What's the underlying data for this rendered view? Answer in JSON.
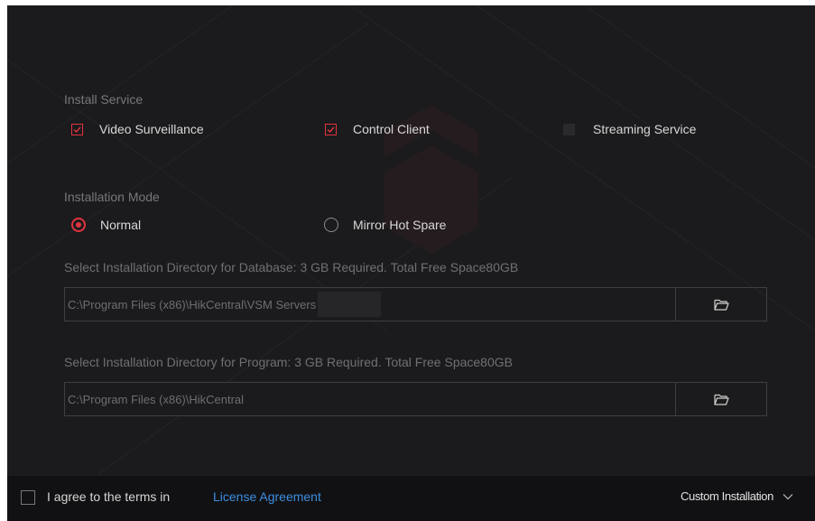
{
  "install_service": {
    "title": "Install Service",
    "options": [
      {
        "label": "Video Surveillance",
        "checked": true
      },
      {
        "label": "Control Client",
        "checked": true
      },
      {
        "label": "Streaming Service",
        "checked": false
      }
    ]
  },
  "installation_mode": {
    "title": "Installation Mode",
    "options": [
      {
        "label": "Normal",
        "selected": true
      },
      {
        "label": "Mirror Hot Spare",
        "selected": false
      }
    ]
  },
  "database_dir": {
    "label": "Select Installation Directory for Database: 3 GB Required. Total Free Space80GB",
    "path": "C:\\Program Files (x86)\\HikCentral\\VSM Servers",
    "browse_icon": "folder-open-icon"
  },
  "program_dir": {
    "label": "Select Installation Directory for Program:  3 GB Required. Total Free Space80GB",
    "path": "C:\\Program Files (x86)\\HikCentral",
    "browse_icon": "folder-open-icon"
  },
  "footer": {
    "agree_text": "I agree to the terms in",
    "license_link": "License Agreement",
    "install_type": "Custom Installation",
    "install_type_icon": "chevron-down-icon"
  },
  "colors": {
    "background": "#1b1b1d",
    "accent": "#e2333f",
    "link": "#3c8ee0",
    "footer": "#111113"
  }
}
